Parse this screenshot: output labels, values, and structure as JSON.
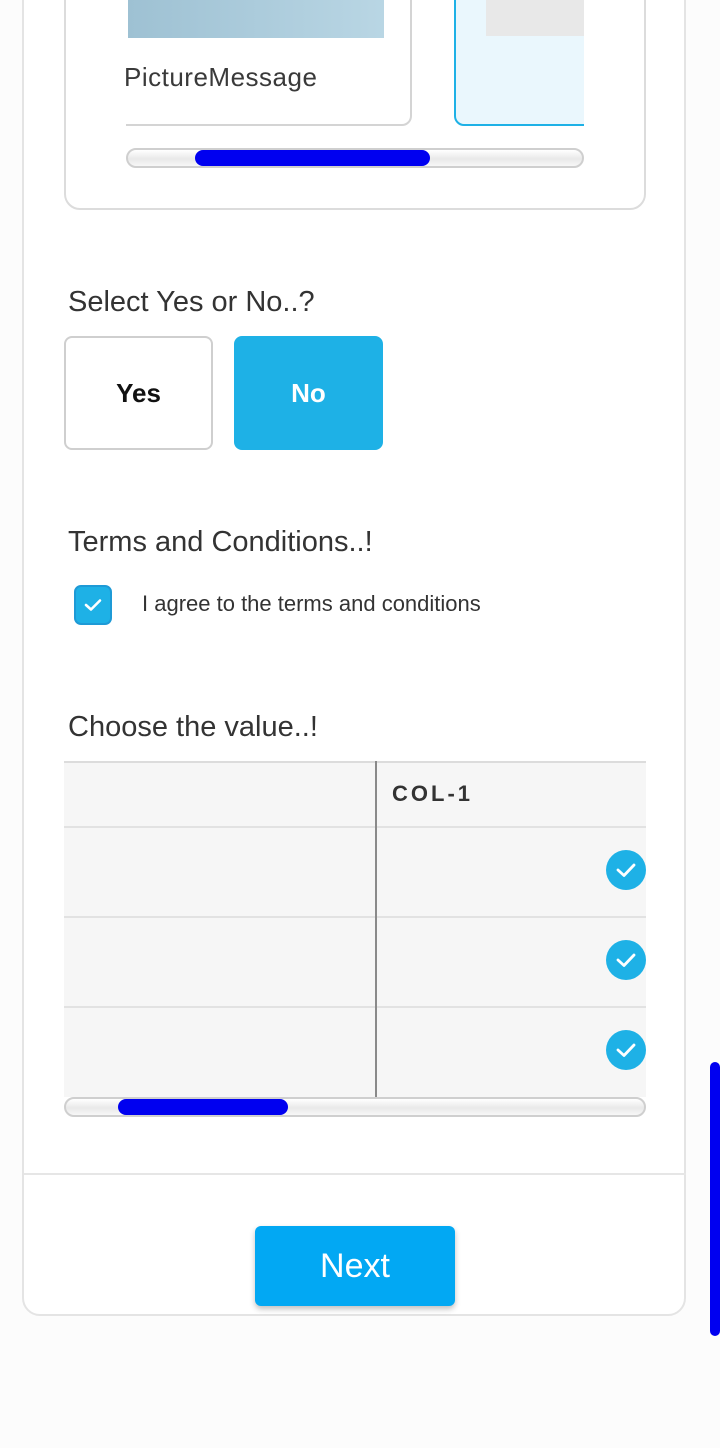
{
  "carousel": {
    "cards": [
      {
        "label": "PictureMessage",
        "selected": false
      },
      {
        "label": "",
        "selected": true
      }
    ],
    "scroll_position_fraction": 0.35
  },
  "yes_no": {
    "question": "Select Yes or No..?",
    "options": [
      "Yes",
      "No"
    ],
    "selected": "No"
  },
  "terms": {
    "title": "Terms and Conditions..!",
    "checkbox_label": "I agree to the terms and conditions",
    "checked": true
  },
  "matrix": {
    "question": "Choose the value..!",
    "columns": [
      "",
      "COL-1"
    ],
    "rows": [
      {
        "label": "",
        "col1_checked": true
      },
      {
        "label": "",
        "col1_checked": true
      },
      {
        "label": "",
        "col1_checked": true
      }
    ],
    "scroll_position_fraction": 0.1
  },
  "footer": {
    "next_label": "Next"
  },
  "colors": {
    "accent": "#1eb1e6",
    "primary_button": "#02a8f3",
    "scrollbar": "#0000f0"
  }
}
